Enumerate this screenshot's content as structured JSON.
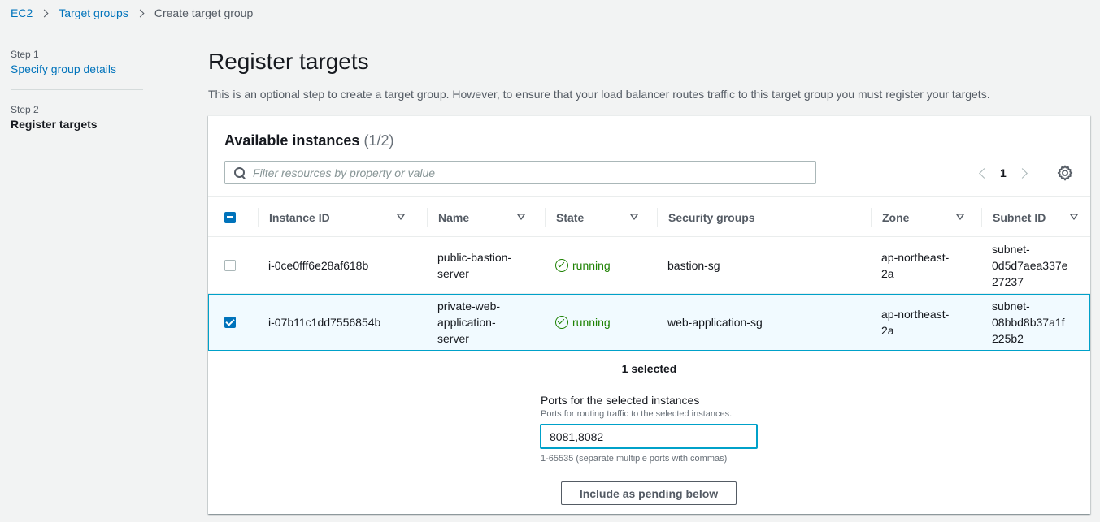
{
  "breadcrumb": {
    "items": [
      {
        "label": "EC2"
      },
      {
        "label": "Target groups"
      },
      {
        "label": "Create target group"
      }
    ]
  },
  "steps": [
    {
      "step_label": "Step 1",
      "title": "Specify group details"
    },
    {
      "step_label": "Step 2",
      "title": "Register targets"
    }
  ],
  "page": {
    "title": "Register targets",
    "description": "This is an optional step to create a target group. However, to ensure that your load balancer routes traffic to this target group you must register your targets."
  },
  "panel": {
    "title": "Available instances",
    "count": "(1/2)",
    "filter_placeholder": "Filter resources by property or value",
    "page_number": "1"
  },
  "table": {
    "columns": [
      "Instance ID",
      "Name",
      "State",
      "Security groups",
      "Zone",
      "Subnet ID"
    ],
    "rows": [
      {
        "checked": false,
        "instance_id": "i-0ce0fff6e28af618b",
        "name_lines": [
          "public-bastion-",
          "server"
        ],
        "state": "running",
        "security_groups": "bastion-sg",
        "zone_lines": [
          "ap-northeast-",
          "2a"
        ],
        "subnet_lines": [
          "subnet-",
          "0d5d7aea337e",
          "27237"
        ]
      },
      {
        "checked": true,
        "instance_id": "i-07b11c1dd7556854b",
        "name_lines": [
          "private-web-",
          "application-",
          "server"
        ],
        "state": "running",
        "security_groups": "web-application-sg",
        "zone_lines": [
          "ap-northeast-",
          "2a"
        ],
        "subnet_lines": [
          "subnet-",
          "08bbd8b37a1f",
          "225b2"
        ]
      }
    ]
  },
  "selection": {
    "selected_text": "1 selected",
    "ports_label": "Ports for the selected instances",
    "ports_description": "Ports for routing traffic to the selected instances.",
    "ports_value": "8081,8082",
    "ports_hint": "1-65535 (separate multiple ports with commas)",
    "include_button": "Include as pending below"
  },
  "colors": {
    "link": "#0073bb",
    "running": "#1d8102",
    "selected_row_bg": "#f1faff",
    "selected_row_border": "#00a1c9"
  }
}
